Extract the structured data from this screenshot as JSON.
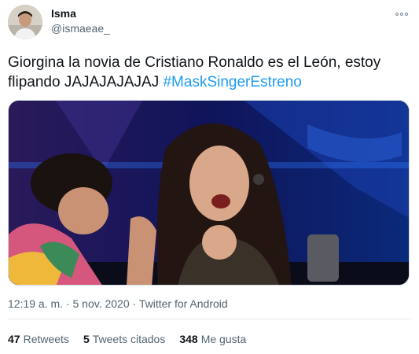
{
  "user": {
    "display_name": "Isma",
    "handle": "@ismaeae_"
  },
  "tweet": {
    "text": "Giorgina la novia de Cristiano Ronaldo es el León, estoy flipando JAJAJAJAJAJ ",
    "hashtag": "#MaskSingerEstreno"
  },
  "meta": {
    "time": "12:19 a. m.",
    "date": "5 nov. 2020",
    "source": "Twitter for Android",
    "separator": " · "
  },
  "stats": {
    "retweets_count": "47",
    "retweets_label": "Retweets",
    "quotes_count": "5",
    "quotes_label": "Tweets citados",
    "likes_count": "348",
    "likes_label": "Me gusta"
  },
  "icons": {
    "more": "more-options-icon"
  },
  "colors": {
    "link": "#1d9bf0",
    "secondary_text": "#536471",
    "primary_text": "#0f1419"
  }
}
